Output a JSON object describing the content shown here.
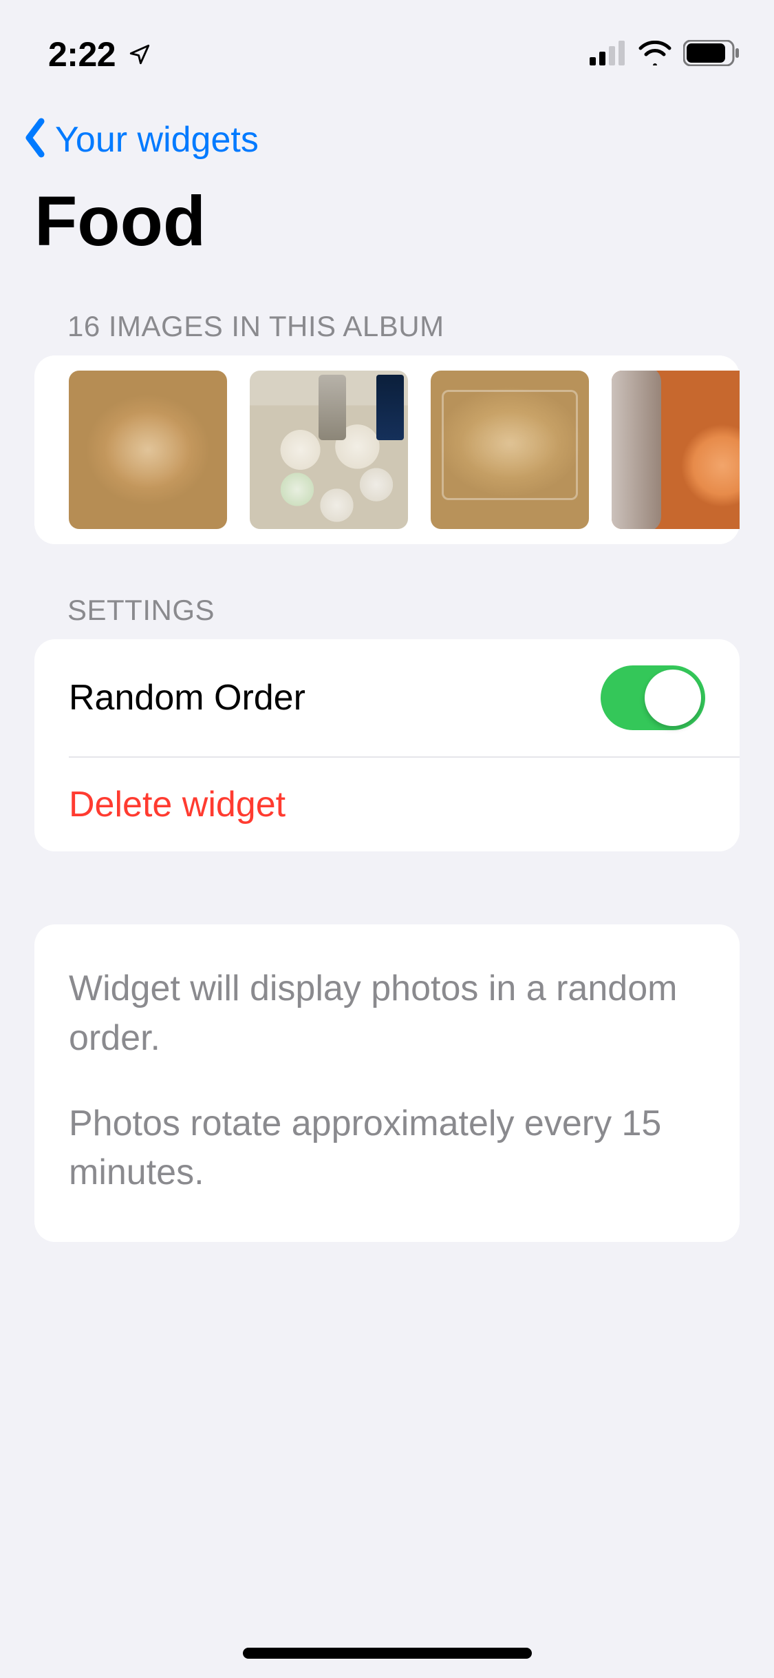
{
  "status": {
    "time": "2:22",
    "location_icon": "location-arrow",
    "cellular_bars": 2,
    "wifi": true,
    "battery_pct": 85
  },
  "nav": {
    "back_label": "Your widgets"
  },
  "header": {
    "title": "Food"
  },
  "album": {
    "header": "16 IMAGES IN THIS ALBUM",
    "count": 16,
    "thumbnails": [
      {
        "alt": "hummus-container"
      },
      {
        "alt": "ingredients-mise-en-place"
      },
      {
        "alt": "hummus-container-closeup"
      },
      {
        "alt": "pot-with-food"
      }
    ]
  },
  "settings": {
    "header": "SETTINGS",
    "random_order_label": "Random Order",
    "random_order_on": true,
    "delete_label": "Delete widget"
  },
  "info": {
    "line1": "Widget will display photos in a random order.",
    "line2": "Photos rotate approximately every 15 minutes."
  },
  "colors": {
    "tint": "#007aff",
    "destructive": "#ff3b30",
    "switch_on": "#34c759",
    "background": "#f2f2f7"
  }
}
